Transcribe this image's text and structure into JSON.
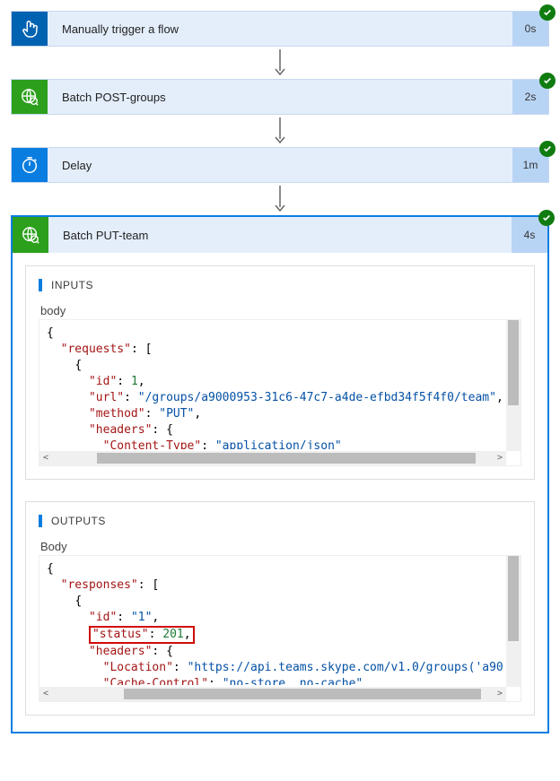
{
  "steps": [
    {
      "title": "Manually trigger a flow",
      "duration": "0s",
      "icon": "touch",
      "iconColor": "ic-blue",
      "success": true
    },
    {
      "title": "Batch POST-groups",
      "duration": "2s",
      "icon": "globe",
      "iconColor": "ic-green",
      "success": true
    },
    {
      "title": "Delay",
      "duration": "1m",
      "icon": "timer",
      "iconColor": "ic-azure",
      "success": true
    },
    {
      "title": "Batch PUT-team",
      "duration": "4s",
      "icon": "globe",
      "iconColor": "ic-green",
      "success": true
    }
  ],
  "detail": {
    "inputs": {
      "heading": "INPUTS",
      "field": "body",
      "json": {
        "requests": [
          {
            "id": 1,
            "url": "/groups/a9000953-31c6-47c7-a4de-efbd34f5f4f0/team",
            "method": "PUT",
            "headers": {
              "Content-Type": "application/json"
            }
          }
        ]
      }
    },
    "outputs": {
      "heading": "OUTPUTS",
      "field": "Body",
      "json": {
        "responses": [
          {
            "id": "1",
            "status": 201,
            "headers": {
              "Location": "https://api.teams.skype.com/v1.0/groups('a90",
              "Cache-Control": "no-store, no-cache"
            }
          }
        ]
      },
      "highlight": "status"
    }
  }
}
